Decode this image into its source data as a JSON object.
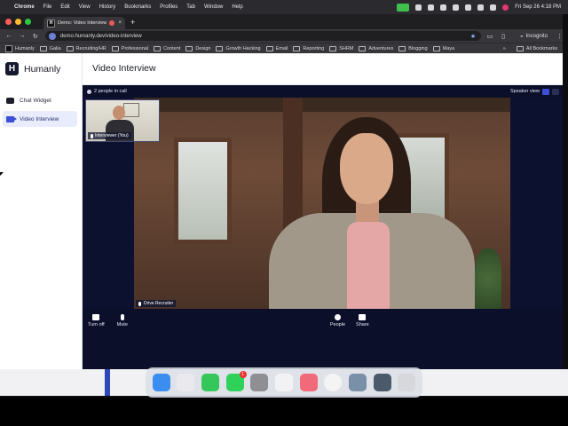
{
  "menubar": {
    "apple": "",
    "items": [
      "Chrome",
      "File",
      "Edit",
      "View",
      "History",
      "Bookmarks",
      "Profiles",
      "Tab",
      "Window",
      "Help"
    ],
    "clock": "Fri Sep 26  4:18 PM"
  },
  "browser": {
    "tab_title": "Demo: Video Interview | H",
    "tab_favicon": "H",
    "url": "demo.humanly.dev/video-interview",
    "incognito_label": "Incognito",
    "bookmarks": [
      "Humanly",
      "Galia",
      "Recruiting/HR",
      "Professional",
      "Content",
      "Design",
      "Growth Hacking",
      "Email",
      "Reporting",
      "SHRM",
      "Adventures",
      "Blogging",
      "Maya"
    ],
    "more_label": "»",
    "all_bookmarks": "All Bookmarks"
  },
  "app": {
    "brand_name": "Humanly",
    "brand_letter": "H",
    "nav": [
      {
        "label": "Chat Widget",
        "active": false
      },
      {
        "label": "Video Interview",
        "active": true
      }
    ],
    "page_title": "Video Interview"
  },
  "call": {
    "people_count": "2 people in call",
    "view_label": "Speaker view",
    "self_label": "Interviewer (You)",
    "remote_label": "Drive Recruiter",
    "controls": {
      "turn_off": "Turn off",
      "mute": "Mute",
      "people": "People",
      "share": "Share"
    }
  },
  "dock": {
    "messages_badge": "1"
  },
  "colors": {
    "accent": "#3d4fd6",
    "call_bg": "#0b0f2a",
    "active_nav_bg": "#e8ecfd"
  }
}
